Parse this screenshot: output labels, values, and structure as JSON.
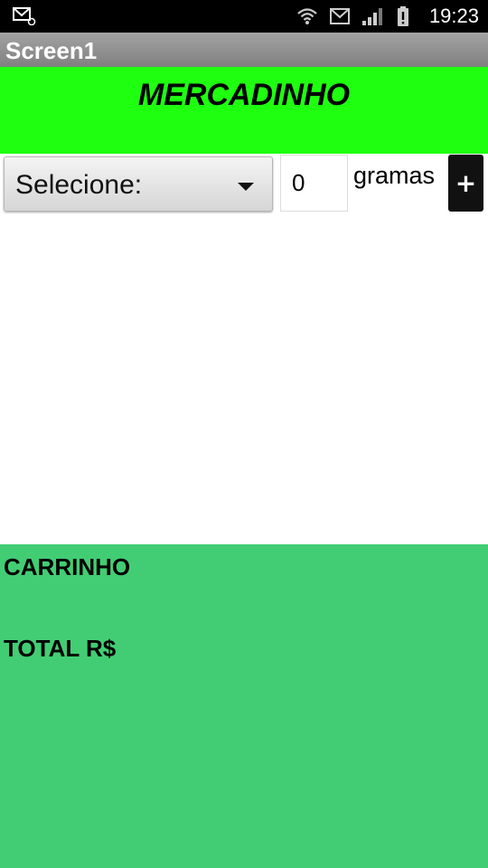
{
  "status_bar": {
    "time": "19:23",
    "left_icon": "mail-notification-icon",
    "right_icons": [
      "wifi-icon",
      "mail-icon",
      "signal-icon",
      "battery-alert-icon"
    ]
  },
  "app_bar": {
    "title": "Screen1"
  },
  "header": {
    "title": "MERCADINHO",
    "background": "#1fff10"
  },
  "controls": {
    "spinner_selected": "Selecione:",
    "quantity_value": "0",
    "unit": "gramas",
    "add_label": "+"
  },
  "cart": {
    "label": "CARRINHO",
    "total_label": "TOTAL R$",
    "background": "#42cd74"
  }
}
